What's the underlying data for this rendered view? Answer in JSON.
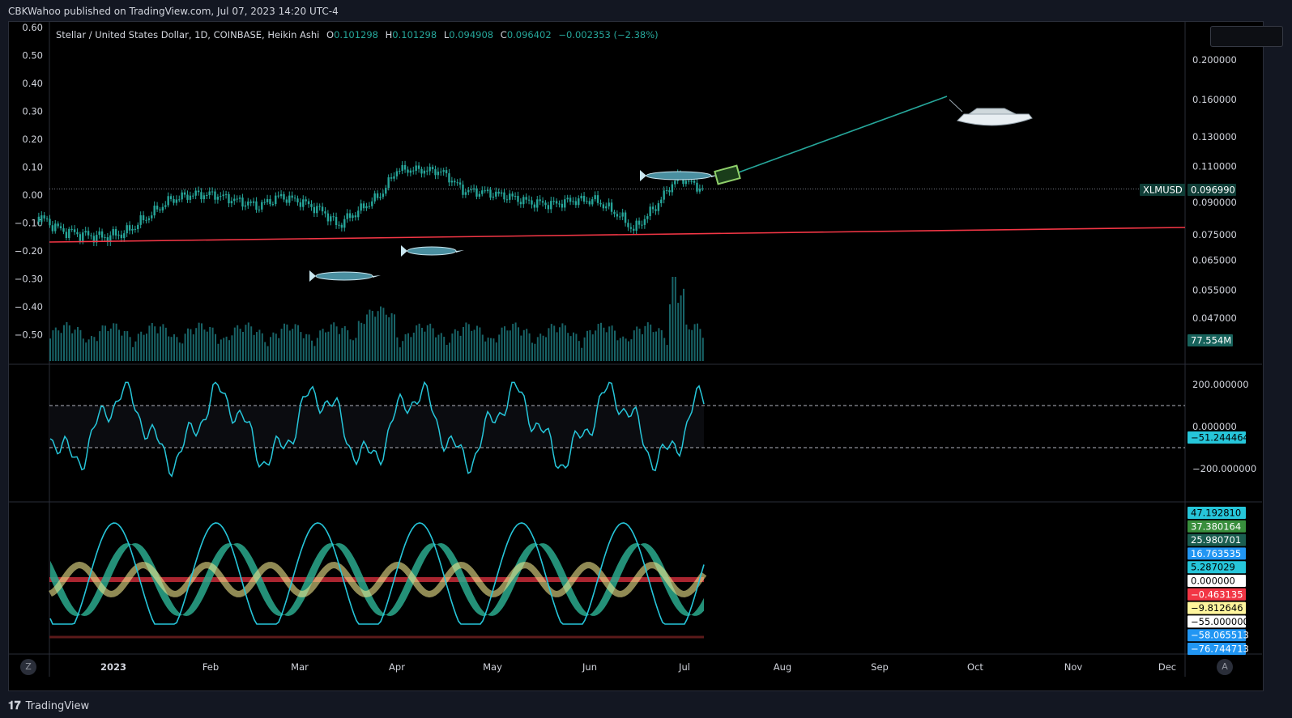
{
  "header": {
    "published": "CBKWahoo published on TradingView.com, Jul 07, 2023 14:20 UTC-4"
  },
  "footer": {
    "brand": "TradingView"
  },
  "legend": {
    "symbol": "Stellar / United States Dollar, 1D, COINBASE, Heikin Ashi",
    "o_label": "O",
    "o_val": "0.101298",
    "h_label": "H",
    "h_val": "0.101298",
    "l_label": "L",
    "l_val": "0.094908",
    "c_label": "C",
    "c_val": "0.096402",
    "chg": "−0.002353 (−2.38%)"
  },
  "buttons": {
    "left": "Z",
    "right": "A"
  },
  "colors": {
    "up": "#26a69a",
    "down": "#26a69a",
    "trendline": "#f23645",
    "cyan": "#26c6da",
    "projection": "#26a69a"
  },
  "chart_data": [
    {
      "type": "candlestick",
      "title": "Stellar / United States Dollar, 1D, COINBASE, Heikin Ashi",
      "x_ticks": [
        "2023",
        "Feb",
        "Mar",
        "Apr",
        "May",
        "Jun",
        "Jul",
        "Aug",
        "Sep",
        "Oct",
        "Nov",
        "Dec"
      ],
      "left_y_ticks": [
        "0.60",
        "0.50",
        "0.40",
        "0.30",
        "0.20",
        "0.10",
        "0.00",
        "−0.10",
        "−0.20",
        "−0.30",
        "−0.40",
        "−0.50"
      ],
      "right_y_ticks": [
        "0.200000",
        "0.160000",
        "0.130000",
        "0.110000",
        "0.090000",
        "0.075000",
        "0.065000",
        "0.055000",
        "0.047000"
      ],
      "y_scale": "log",
      "symbol_label": "XLMUSD",
      "last_price": "0.096990",
      "volume_label": "77.554M",
      "approx_close_path": [
        {
          "x": "Dec 8",
          "y": 0.083
        },
        {
          "x": "Dec 15",
          "y": 0.077
        },
        {
          "x": "Dec 22",
          "y": 0.075
        },
        {
          "x": "Dec 29",
          "y": 0.074
        },
        {
          "x": "Jan 5",
          "y": 0.076
        },
        {
          "x": "Jan 12",
          "y": 0.083
        },
        {
          "x": "Jan 19",
          "y": 0.091
        },
        {
          "x": "Jan 26",
          "y": 0.094
        },
        {
          "x": "Feb 2",
          "y": 0.094
        },
        {
          "x": "Feb 9",
          "y": 0.091
        },
        {
          "x": "Feb 16",
          "y": 0.088
        },
        {
          "x": "Feb 23",
          "y": 0.093
        },
        {
          "x": "Mar 2",
          "y": 0.09
        },
        {
          "x": "Mar 9",
          "y": 0.085
        },
        {
          "x": "Mar 13",
          "y": 0.079
        },
        {
          "x": "Mar 20",
          "y": 0.086
        },
        {
          "x": "Mar 27",
          "y": 0.094
        },
        {
          "x": "Apr 1",
          "y": 0.108
        },
        {
          "x": "Apr 8",
          "y": 0.108
        },
        {
          "x": "Apr 15",
          "y": 0.107
        },
        {
          "x": "Apr 22",
          "y": 0.096
        },
        {
          "x": "Apr 29",
          "y": 0.095
        },
        {
          "x": "May 6",
          "y": 0.093
        },
        {
          "x": "May 13",
          "y": 0.09
        },
        {
          "x": "May 20",
          "y": 0.089
        },
        {
          "x": "May 27",
          "y": 0.091
        },
        {
          "x": "Jun 3",
          "y": 0.091
        },
        {
          "x": "Jun 10",
          "y": 0.084
        },
        {
          "x": "Jun 15",
          "y": 0.077
        },
        {
          "x": "Jun 22",
          "y": 0.088
        },
        {
          "x": "Jun 29",
          "y": 0.104
        },
        {
          "x": "Jul 7",
          "y": 0.0964
        }
      ],
      "trendline": [
        {
          "x": "Dec 1",
          "y": 0.073
        },
        {
          "x": "Dec 31",
          "y": 0.078
        }
      ],
      "projection": [
        {
          "x": "Jul 12",
          "y": 0.101
        },
        {
          "x": "Sep 25",
          "y": 0.17
        }
      ]
    },
    {
      "type": "line",
      "y_ticks": [
        "200.000000",
        "0.000000",
        "−200.000000"
      ],
      "current_value": "−51.244464",
      "levels": [
        100,
        -100
      ]
    },
    {
      "type": "area",
      "labels": [
        "47.192810",
        "37.380164",
        "25.980701",
        "16.763535",
        "5.287029",
        "0.000000",
        "−0.463135",
        "−9.812646",
        "−55.000000",
        "−58.065513",
        "−76.744713"
      ],
      "label_colors": [
        "#26c6da",
        "#388e3c",
        "#1b5e50",
        "#2196f3",
        "#26c6da",
        "#ffffff",
        "#f23645",
        "#fff59d",
        "#ffffff",
        "#2196f3",
        "#2196f3"
      ]
    }
  ]
}
